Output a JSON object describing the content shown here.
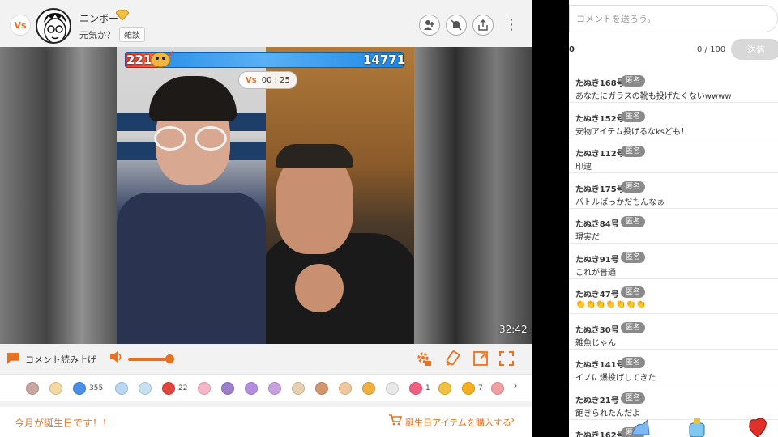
{
  "header": {
    "vs_logo": "Vs",
    "streamer_name": "ニンボー",
    "status": "元気か？",
    "genre": "雑談"
  },
  "battle": {
    "left_score": "2210",
    "right_score": "14771",
    "left_fraction": 0.13,
    "timer_vs": "Vs",
    "timer": "00 : 25",
    "duration": "32:42"
  },
  "controls": {
    "tts_label": "コメント読み上げ",
    "volume_level": 0.9
  },
  "gifts": [
    {
      "icon": "bowl-icon",
      "color": "#c9a7a0",
      "count": ""
    },
    {
      "icon": "cake-icon",
      "color": "#f5d7a0",
      "count": ""
    },
    {
      "icon": "rocket-icon",
      "color": "#4a8ee8",
      "count": "355"
    },
    {
      "icon": "jellyfish-icon",
      "color": "#b7d7f5",
      "count": ""
    },
    {
      "icon": "plate-icon",
      "color": "#c6e0f0",
      "count": ""
    },
    {
      "icon": "heart-box-icon",
      "color": "#e0463e",
      "count": "22"
    },
    {
      "icon": "pig-icon",
      "color": "#f5b7c8",
      "count": ""
    },
    {
      "icon": "purple-ball-icon",
      "color": "#9c7fc8",
      "count": ""
    },
    {
      "icon": "violet-ball-icon",
      "color": "#b38de0",
      "count": ""
    },
    {
      "icon": "donut-icon",
      "color": "#c8a0e0",
      "count": ""
    },
    {
      "icon": "mushroom-icon",
      "color": "#e6d0b0",
      "count": ""
    },
    {
      "icon": "cookie-icon",
      "color": "#d09870",
      "count": ""
    },
    {
      "icon": "drink-icon",
      "color": "#f0c8a0",
      "count": ""
    },
    {
      "icon": "bear-icon",
      "color": "#f0b040",
      "count": ""
    },
    {
      "icon": "cup-icon",
      "color": "#e8e8e8",
      "count": ""
    },
    {
      "icon": "bow-icon",
      "color": "#f06080",
      "count": "1"
    },
    {
      "icon": "coin-icon",
      "color": "#f0c040",
      "count": ""
    },
    {
      "icon": "balloon-icon",
      "color": "#f5b020",
      "count": "7"
    },
    {
      "icon": "candle-icon",
      "color": "#f0a0a0",
      "count": ""
    }
  ],
  "birthday": {
    "message": "今月が誕生日です！！",
    "link": "誕生日アイテムを購入する"
  },
  "comments_panel": {
    "input_placeholder": "コメントを送ろう。",
    "zero_mark": "0",
    "char_count": "0 / 100",
    "send_label": "送信",
    "anon_badge": "匿名"
  },
  "comments": [
    {
      "user": "たぬき168号",
      "text": "あなたにガラスの靴も投げたくないwwww"
    },
    {
      "user": "たぬき152号",
      "text": "安物アイテム投げるなksども！"
    },
    {
      "user": "たぬき112号",
      "text": "印逮"
    },
    {
      "user": "たぬき175号",
      "text": "バトルばっかだもんなぁ"
    },
    {
      "user": "たぬき84号",
      "text": "現実だ"
    },
    {
      "user": "たぬき91号",
      "text": "これが普通"
    },
    {
      "user": "たぬき47号",
      "text": "👏👏👏👏👏👏👏"
    },
    {
      "user": "たぬき30号",
      "text": "雑魚じゃん"
    },
    {
      "user": "たぬき141号",
      "text": "イノに爆投げしてきた"
    },
    {
      "user": "たぬき21号",
      "text": "飽きられたんだよ"
    },
    {
      "user": "たぬき162号",
      "text": ""
    }
  ]
}
